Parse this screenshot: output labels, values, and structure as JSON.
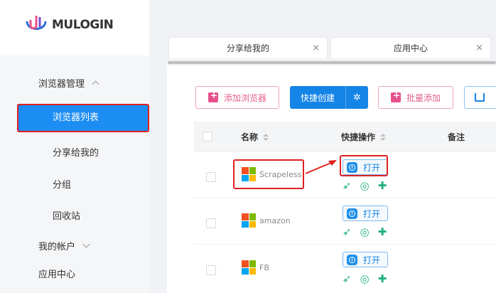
{
  "app": {
    "logo_text": "MULOGIN"
  },
  "sidebar": {
    "browser_mgmt": "浏览器管理",
    "browser_list": "浏览器列表",
    "shared_with_me": "分享给我的",
    "groups": "分组",
    "recycle_bin": "回收站",
    "my_account": "我的帐户",
    "app_center": "应用中心"
  },
  "tabs": [
    {
      "label": "分享给我的",
      "close": "×"
    },
    {
      "label": "应用中心",
      "close": "×"
    }
  ],
  "toolbar": {
    "add_browser": "添加浏览器",
    "quick_create": "快捷创建",
    "spin_icon": "✲",
    "batch_add": "批量添加"
  },
  "table": {
    "headers": [
      "名称",
      "快捷操作",
      "备注"
    ],
    "open_label": "打开",
    "rows": [
      {
        "name": "Scrapeless"
      },
      {
        "name": "amazon"
      },
      {
        "name": "FB"
      }
    ]
  },
  "colors": {
    "accent": "#1484e6",
    "highlight": "#e0201f",
    "pink": "#e0608e",
    "green": "#1fb080"
  },
  "icons": {
    "quick_ops": [
      "rocket-icon",
      "fingerprint-icon",
      "puzzle-icon"
    ],
    "row_os": "windows-icon"
  }
}
